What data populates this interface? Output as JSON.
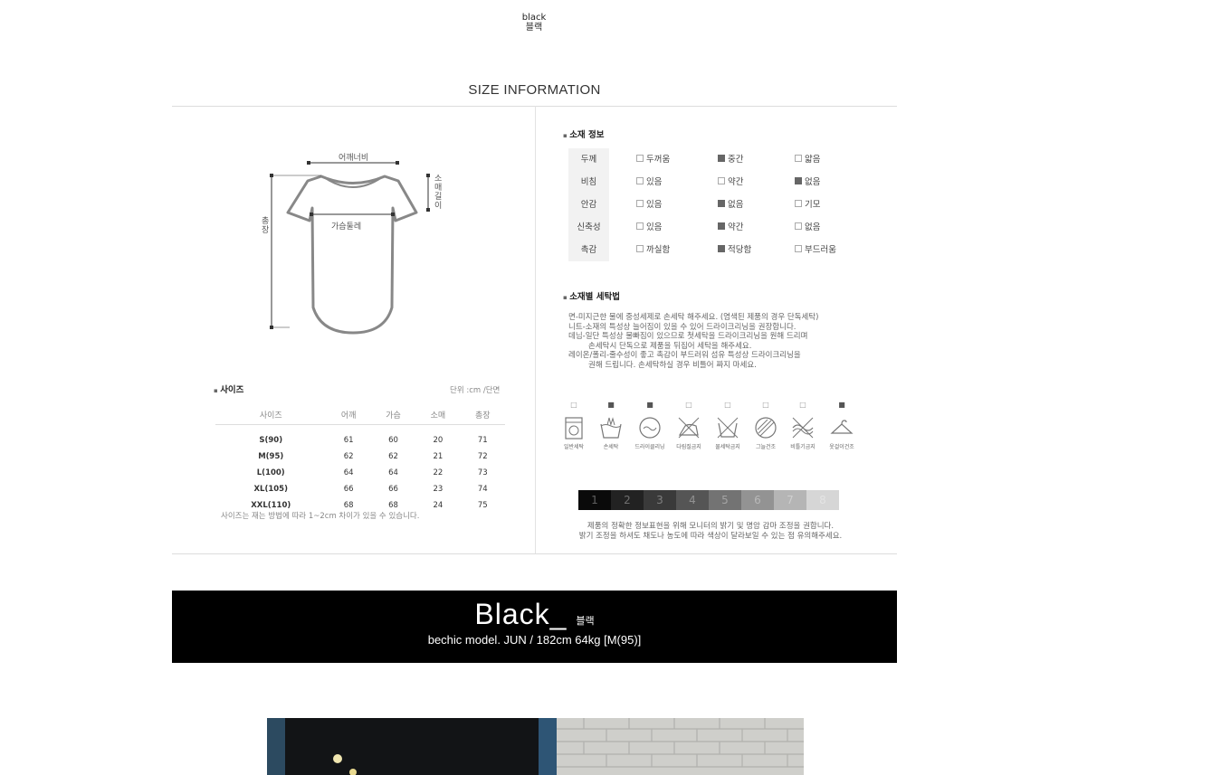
{
  "color_option": {
    "en": "black",
    "ko": "블랙"
  },
  "size_info_title": "SIZE INFORMATION",
  "diagram": {
    "shoulder": "어깨너비",
    "sleeve": "소매길이",
    "chest": "가슴둘레",
    "length": "총장"
  },
  "size_section": {
    "title": "사이즈",
    "unit": "단위 :cm /단면",
    "headers": [
      "사이즈",
      "어깨",
      "가슴",
      "소매",
      "총장"
    ],
    "rows": [
      [
        "S(90)",
        "61",
        "60",
        "20",
        "71"
      ],
      [
        "M(95)",
        "62",
        "62",
        "21",
        "72"
      ],
      [
        "L(100)",
        "64",
        "64",
        "22",
        "73"
      ],
      [
        "XL(105)",
        "66",
        "66",
        "23",
        "74"
      ],
      [
        "XXL(110)",
        "68",
        "68",
        "24",
        "75"
      ]
    ],
    "note": "사이즈는 재는 방법에 따라 1~2cm 차이가 있을 수 있습니다."
  },
  "fabric_section": {
    "title": "소재 정보",
    "rows": [
      {
        "label": "두께",
        "options": [
          "두꺼움",
          "중간",
          "얇음"
        ],
        "selected": 1
      },
      {
        "label": "비침",
        "options": [
          "있음",
          "약간",
          "없음"
        ],
        "selected": 2
      },
      {
        "label": "안감",
        "options": [
          "있음",
          "없음",
          "기모"
        ],
        "selected": 1
      },
      {
        "label": "신축성",
        "options": [
          "있음",
          "약간",
          "없음"
        ],
        "selected": 1
      },
      {
        "label": "촉감",
        "options": [
          "까실함",
          "적당함",
          "부드러움"
        ],
        "selected": 1
      }
    ]
  },
  "wash_section": {
    "title": "소재별 세탁법",
    "lines": [
      "면-미지근한 물에 중성세제로 손세탁 해주세요. (염색된 제품의 경우 단독세탁)",
      "니트-소재의 특성상 늘어짐이 있을 수 있어 드라이크리닝을 권장합니다.",
      "데님-일단 특성상 물빠짐이 있으므로 첫세탁을 드라이크리닝을 원해 드리며",
      "손세탁시 단독으로 제품을 뒤집어 세탁을 해주세요.",
      "레이온/폴리-줄수성이 좋고 촉감이 부드러워 섬유 특성상 드라이크리닝을",
      "권해 드립니다. 손세탁하실 경우 비틀어 짜지 마세요."
    ]
  },
  "care_icons": [
    {
      "label": "일반세탁",
      "icon": "washing-machine-icon",
      "checked": false
    },
    {
      "label": "손세탁",
      "icon": "hand-wash-icon",
      "checked": true
    },
    {
      "label": "드라이클리닝",
      "icon": "dry-clean-icon",
      "checked": true
    },
    {
      "label": "다림질금지",
      "icon": "no-iron-icon",
      "checked": false
    },
    {
      "label": "물세탁금지",
      "icon": "no-water-wash-icon",
      "checked": false
    },
    {
      "label": "그늘건조",
      "icon": "shade-dry-icon",
      "checked": false
    },
    {
      "label": "비틀기금지",
      "icon": "no-wring-icon",
      "checked": false
    },
    {
      "label": "옷걸이건조",
      "icon": "hanger-dry-icon",
      "checked": true
    }
  ],
  "tone_scale": {
    "labels": [
      "1",
      "2",
      "3",
      "4",
      "5",
      "6",
      "7",
      "8"
    ],
    "colors": [
      "#0a0a0a",
      "#222222",
      "#3a3a3a",
      "#555555",
      "#737373",
      "#939393",
      "#b5b5b5",
      "#d6d6d6"
    ]
  },
  "tone_note": [
    "제품의 정확한 정보표현을 위해 모니터의 밝기 및 명암 감마 조정을 권합니다.",
    "밝기 조정을 하셔도 채도나 농도에 따라 색상이 달라보일 수 있는 점 유의해주세요."
  ],
  "banner": {
    "title": "Black",
    "title_ko": "블랙",
    "subtitle": "bechic model. JUN / 182cm 64kg [M(95)]"
  }
}
